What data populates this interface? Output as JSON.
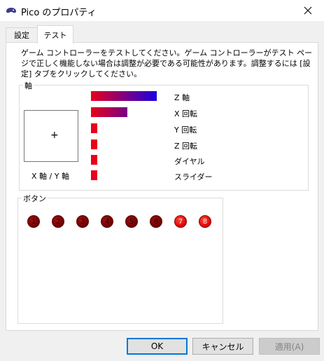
{
  "window": {
    "title": "Pico のプロパティ"
  },
  "tabs": [
    {
      "label": "設定",
      "active": false
    },
    {
      "label": "テスト",
      "active": true
    }
  ],
  "description": "ゲーム コントローラーをテストしてください。ゲーム コントローラーがテスト ページで正しく機能しない場合は調整が必要である可能性があります。調整するには [設定] タブをクリックしてください。",
  "axes_group": {
    "label": "軸",
    "xy_label": "X 軸 / Y 軸",
    "crosshair": "+",
    "axes": [
      {
        "label": "Z 軸",
        "level": 1.0
      },
      {
        "label": "X 回転",
        "level": 0.55
      },
      {
        "label": "Y 回転",
        "level": 0.1
      },
      {
        "label": "Z 回転",
        "level": 0.1
      },
      {
        "label": "ダイヤル",
        "level": 0.1
      },
      {
        "label": "スライダー",
        "level": 0.1
      }
    ]
  },
  "buttons_group": {
    "label": "ボタン",
    "buttons": [
      {
        "label": "1",
        "pressed": false
      },
      {
        "label": "2",
        "pressed": false
      },
      {
        "label": "3",
        "pressed": false
      },
      {
        "label": "4",
        "pressed": false
      },
      {
        "label": "5",
        "pressed": false
      },
      {
        "label": "6",
        "pressed": false
      },
      {
        "label": "7",
        "pressed": true
      },
      {
        "label": "8",
        "pressed": true
      }
    ]
  },
  "dialog_buttons": {
    "ok": "OK",
    "cancel": "キャンセル",
    "apply": "適用(A)"
  },
  "colors": {
    "bar_start": "#e8001c",
    "bar_end": "#1a00e0",
    "led_off": "#7a0000",
    "led_on": "#ff2a1a",
    "focus_border": "#0078d7"
  }
}
